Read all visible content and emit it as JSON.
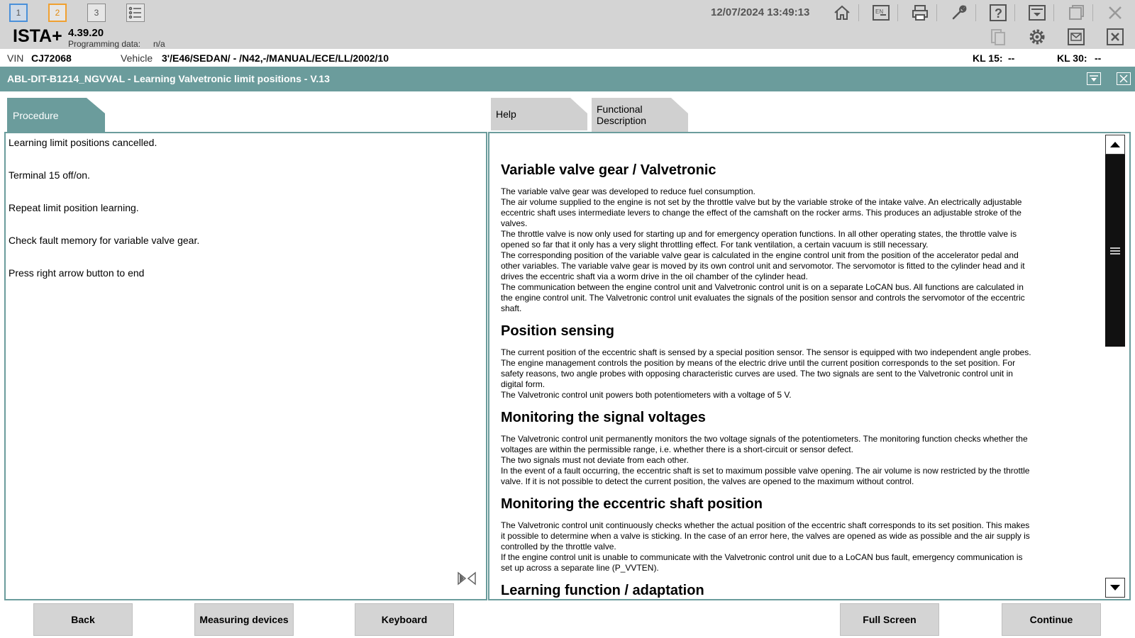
{
  "toolbar": {
    "tabs": [
      "1",
      "2",
      "3"
    ],
    "datetime": "12/07/2024 13:49:13"
  },
  "app": {
    "name": "ISTA+",
    "version": "4.39.20",
    "programming_label": "Programming data:",
    "programming_value": "n/a"
  },
  "info": {
    "vin_label": "VIN",
    "vin_value": "CJ72068",
    "vehicle_label": "Vehicle",
    "vehicle_value": "3'/E46/SEDAN/ - /N42,-/MANUAL/ECE/LL/2002/10",
    "kl15_label": "KL 15:",
    "kl15_value": "--",
    "kl30_label": "KL 30:",
    "kl30_value": "--"
  },
  "window": {
    "title": "ABL-DIT-B1214_NGVVAL - Learning Valvetronic limit positions - V.13"
  },
  "tabs": {
    "procedure": "Procedure",
    "help": "Help",
    "functional_line1": "Functional",
    "functional_line2": "Description"
  },
  "procedure_lines": [
    "Learning limit positions cancelled.",
    "Terminal 15 off/on.",
    "Repeat limit position learning.",
    "Check fault memory for variable valve gear.",
    "Press right arrow button to end"
  ],
  "doc": {
    "sections": [
      {
        "heading": "Variable valve gear / Valvetronic",
        "paragraphs": [
          "The variable valve gear was developed to reduce fuel consumption.",
          "The air volume supplied to the engine is not set by the throttle valve but by the variable stroke of the intake valve. An electrically adjustable eccentric shaft uses intermediate levers to change the effect of the camshaft on the rocker arms. This produces an adjustable stroke of the valves.",
          "The throttle valve is now only used for starting up and for emergency operation functions. In all other operating states, the throttle valve is opened so far that it only has a very slight throttling effect. For tank ventilation, a certain vacuum is still necessary.",
          "The corresponding position of the variable valve gear is calculated in the engine control unit from the position of the accelerator pedal and other variables. The variable valve gear is moved by its own control unit and servomotor. The servomotor is fitted to the cylinder head and it drives the eccentric shaft via a worm drive in the oil chamber of the cylinder head.",
          "The communication between the engine control unit and Valvetronic control unit is on a separate LoCAN bus. All functions are calculated in the engine control unit. The Valvetronic control unit evaluates the signals of the position sensor and controls the servomotor of the eccentric shaft."
        ]
      },
      {
        "heading": "Position sensing",
        "paragraphs": [
          "The current position of the eccentric shaft is sensed by a special position sensor. The sensor is equipped with two independent angle probes. The engine management controls the position by means of the electric drive until the current position corresponds to the set position. For safety reasons, two angle probes with opposing characteristic curves are used. The two signals are sent to the Valvetronic control unit in digital form.",
          "The Valvetronic control unit powers both potentiometers with a voltage of 5 V."
        ]
      },
      {
        "heading": "Monitoring the signal voltages",
        "paragraphs": [
          "The Valvetronic control unit permanently monitors the two voltage signals of the potentiometers. The monitoring function checks whether the voltages are within the permissible range, i.e. whether there is a short-circuit or sensor defect.",
          "The two signals must not deviate from each other.",
          "In the event of a fault occurring, the eccentric shaft is set to maximum possible valve opening. The air volume is now restricted by the throttle valve. If it is not possible to detect the current position, the valves are opened to the maximum without control."
        ]
      },
      {
        "heading": "Monitoring the eccentric shaft position",
        "paragraphs": [
          "The Valvetronic control unit continuously checks whether the actual position of the eccentric shaft corresponds to its set position. This makes it possible to determine when a valve is sticking. In the case of an error here, the valves are opened as wide as possible and the air supply is controlled by the throttle valve.",
          "If the engine control unit is unable to communicate with the Valvetronic control unit due to a LoCAN bus fault, emergency communication is set up across a separate line (P_VVTEN)."
        ]
      },
      {
        "heading": "Learning function / adaptation",
        "paragraphs": []
      }
    ]
  },
  "buttons": {
    "back": "Back",
    "measuring": "Measuring devices",
    "keyboard": "Keyboard",
    "fullscreen": "Full Screen",
    "continue": "Continue"
  }
}
